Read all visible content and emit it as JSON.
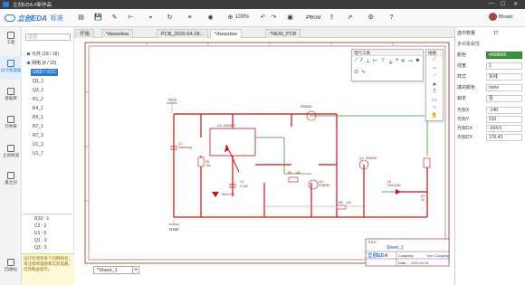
{
  "titlebar": {
    "title": "立创EDA #新作品",
    "min": "—",
    "max": "☐",
    "close": "✕"
  },
  "toolbar": {
    "brand": "立创EDA",
    "edition": "标准",
    "zoom": "100%",
    "bom": "BOM",
    "user": "Bhaskr"
  },
  "rail": [
    {
      "label": "工程",
      "icon": "folder-icon"
    },
    {
      "label": "设计管理器",
      "icon": "design-manager-icon"
    },
    {
      "label": "基础库",
      "icon": "library-icon"
    },
    {
      "label": "元件库",
      "icon": "components-icon"
    },
    {
      "label": "立创商城",
      "icon": "shop-icon"
    },
    {
      "label": "嘉立创",
      "icon": "jlc-icon"
    },
    {
      "label": "回收站",
      "icon": "trash-icon"
    }
  ],
  "leftpanel": {
    "search_placeholder": "过滤",
    "tree": [
      {
        "label": "元件 (18 / 18)",
        "selected": false
      },
      {
        "label": "网络 (8 / 10)",
        "selected": false
      },
      {
        "label": "GND / VCC",
        "selected": true
      },
      {
        "label": "Q1_1",
        "selected": false
      },
      {
        "label": "Q3_1",
        "selected": false
      },
      {
        "label": "R1_2",
        "selected": false
      },
      {
        "label": "R4_1",
        "selected": false
      },
      {
        "label": "R5_1",
        "selected": false
      },
      {
        "label": "R7_1",
        "selected": false
      },
      {
        "label": "R7_3",
        "selected": false
      },
      {
        "label": "U1_3",
        "selected": false
      },
      {
        "label": "U1_7",
        "selected": false
      }
    ],
    "parts": [
      "R10 : 1",
      "C2 : 2",
      "U1 : 6",
      "Q1 : 3",
      "Q3 : 3"
    ],
    "warning": "设计检测到多个同网络名，请注意原理图和实际电路，可忽略此提示。"
  },
  "tabs": [
    {
      "label": "开始",
      "active": false
    },
    {
      "label": "*dwasdwa",
      "active": false
    },
    {
      "label": "PCB_2020-04-28...",
      "active": false
    },
    {
      "label": "*dwasdaw",
      "active": true
    },
    {
      "label": "*NEW_PCB",
      "active": false
    }
  ],
  "canvas": {
    "labels": {
      "vcc": "VCC",
      "gnd": "GND",
      "u1": "U1",
      "u1_part": "NE555P",
      "ss8050": "SS8050",
      "red_led": "Red LED",
      "c1": "C1",
      "samsung": "Samsung",
      "r4": "R4",
      "r4v": "10k",
      "r6": "R6",
      "r6v": "10k",
      "c2": "C2",
      "c2v": "2.2uF",
      "q3": "Q3",
      "q3v": "SS8050",
      "q2": "Q2",
      "q2v": "SS8050",
      "d1": "D1",
      "d1v": "1N4733A",
      "r8": "R8",
      "r8v": "10k",
      "r7": "R7",
      "r7v": "1k"
    },
    "titleblock": {
      "title_label": "TITLE:",
      "title": "Sheet_1",
      "company_label": "Company:",
      "company": "Your Company",
      "date_label": "Date:",
      "date": "2020-04-28",
      "logo": "立创EDA"
    }
  },
  "sheet_tab": "*Sheet_1",
  "add_sheet": "+",
  "tools": {
    "electric_title": "电气工具",
    "drawing_title": "绘图"
  },
  "rightpanel": {
    "title": "选中数量",
    "count": "17",
    "section": "多对象属性",
    "rows": [
      {
        "label": "颜色",
        "value": "#008800",
        "green": true
      },
      {
        "label": "线宽",
        "value": "1"
      },
      {
        "label": "样式",
        "value": "实线"
      },
      {
        "label": "填充颜色",
        "value": "none"
      },
      {
        "label": "锁定",
        "value": "否"
      }
    ],
    "coords": [
      {
        "label": "光标X",
        "value": "-140"
      },
      {
        "label": "光标Y",
        "value": "310"
      },
      {
        "label": "光标DX",
        "value": "-304.5"
      },
      {
        "label": "光标DY",
        "value": "176.43"
      }
    ]
  }
}
